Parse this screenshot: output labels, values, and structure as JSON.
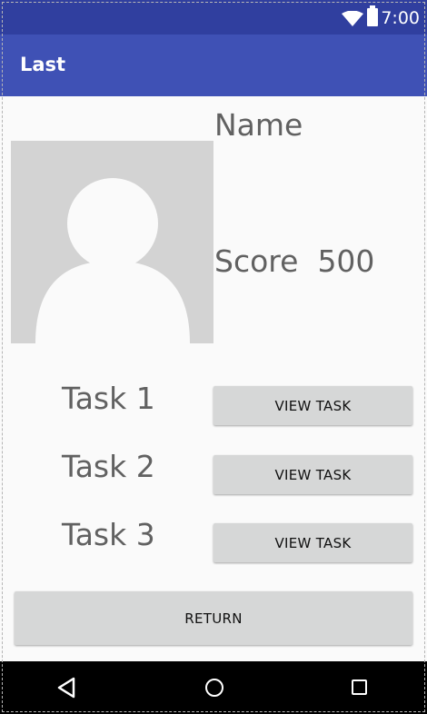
{
  "status_bar": {
    "time": "7:00",
    "icons": [
      "wifi-icon",
      "battery-icon"
    ]
  },
  "app_bar": {
    "title": "Last"
  },
  "profile": {
    "avatar": "person-placeholder-icon",
    "name": "Name",
    "score_label": "Score",
    "score_value": "500"
  },
  "tasks": [
    {
      "label": "Task 1",
      "button": "VIEW TASK"
    },
    {
      "label": "Task 2",
      "button": "VIEW TASK"
    },
    {
      "label": "Task 3",
      "button": "VIEW TASK"
    }
  ],
  "return_button": "RETURN",
  "nav_bar": {
    "icons": [
      "back-icon",
      "home-icon",
      "recents-icon"
    ]
  },
  "colors": {
    "status_bar": "#303f9f",
    "app_bar": "#3f51b5",
    "background": "#fafafa",
    "button": "#d6d7d7",
    "text": "#616161"
  }
}
